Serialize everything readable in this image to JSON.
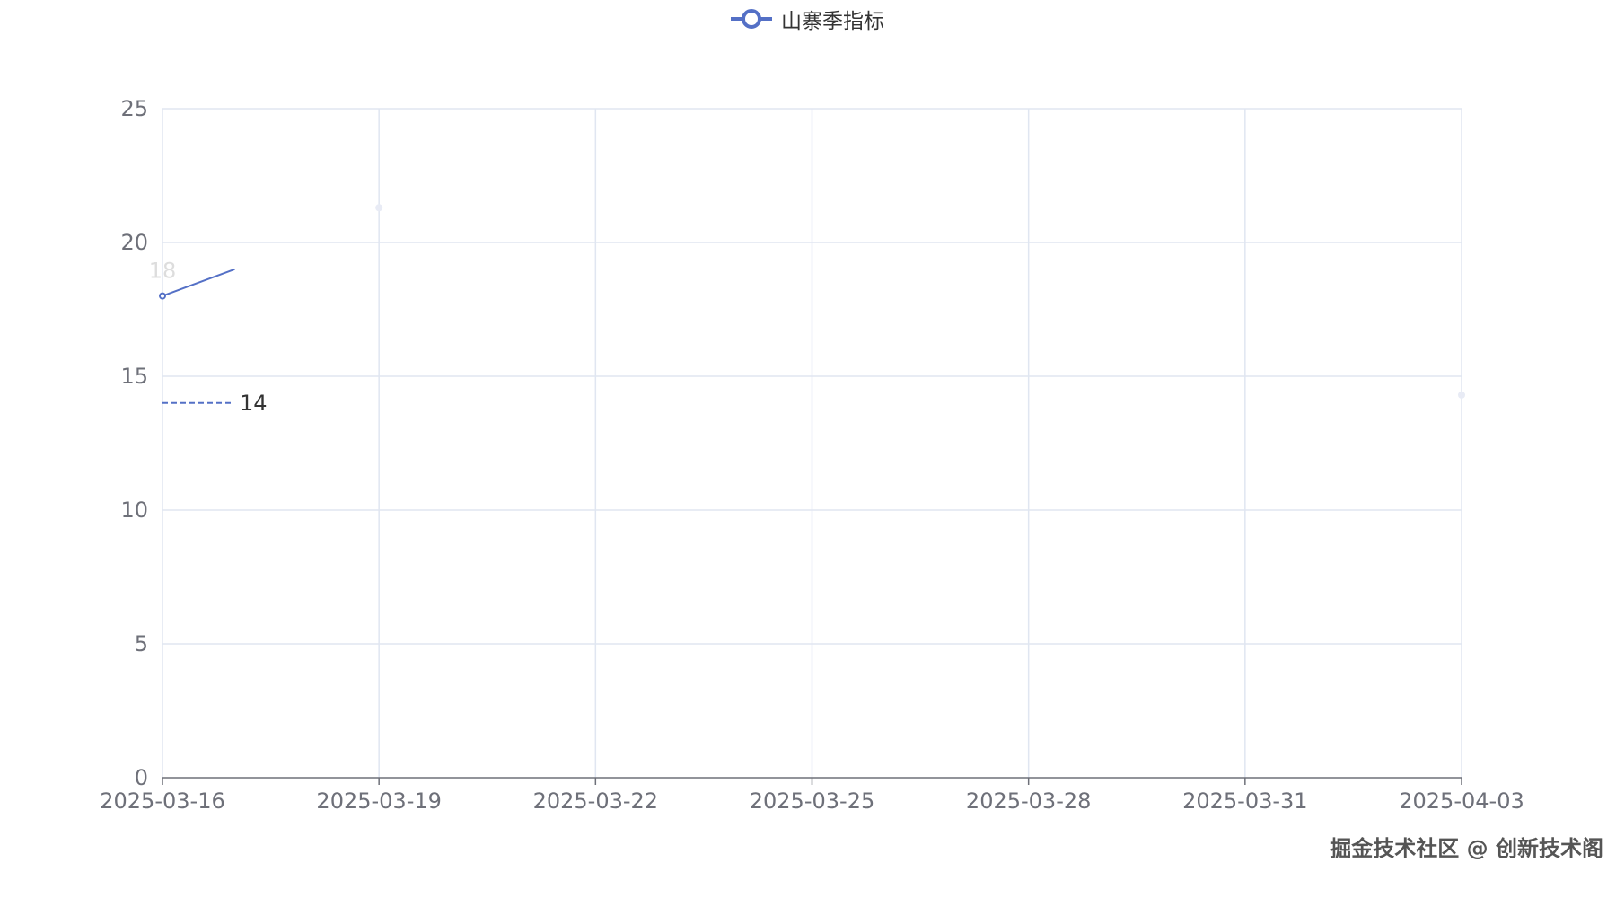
{
  "chart_data": {
    "type": "line",
    "x_tick_labels": [
      "2025-03-16",
      "2025-03-19",
      "2025-03-22",
      "2025-03-25",
      "2025-03-28",
      "2025-03-31",
      "2025-04-03"
    ],
    "y_tick_labels": [
      "0",
      "5",
      "10",
      "15",
      "20",
      "25"
    ],
    "ylim": [
      0,
      25
    ],
    "xlim": [
      "2025-03-16",
      "2025-04-03"
    ],
    "grid": true,
    "legend_position": "top-center",
    "series": [
      {
        "name": "山寨季指标",
        "color": "#5470c6",
        "points": [
          {
            "x": "2025-03-16",
            "y": 18
          },
          {
            "x": "2025-03-17",
            "y": 19
          }
        ],
        "point_labels": [
          "18"
        ]
      }
    ],
    "faded_points": [
      {
        "x": "2025-03-19",
        "y": 21.3
      },
      {
        "x": "2025-04-03",
        "y": 14.3
      }
    ],
    "mark_line": {
      "y": 14,
      "label": "14",
      "style": "dashed"
    }
  },
  "legend": {
    "label": "山寨季指标",
    "icon": "line-circle-icon"
  },
  "watermark": {
    "text": "掘金技术社区 @ 创新技术阁"
  }
}
